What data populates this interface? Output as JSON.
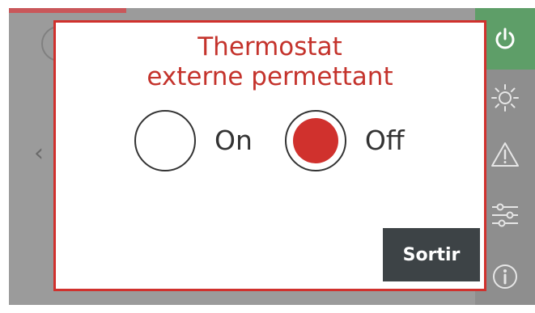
{
  "dialog": {
    "title": "Thermostat\nexterne permettant",
    "options": [
      {
        "label": "On",
        "selected": false
      },
      {
        "label": "Off",
        "selected": true
      }
    ],
    "exit_label": "Sortir"
  },
  "background": {
    "back_icon": "chevron-left-icon"
  },
  "sidebar": {
    "items": [
      {
        "icon": "power-icon",
        "active": true
      },
      {
        "icon": "sun-icon",
        "active": false
      },
      {
        "icon": "warning-icon",
        "active": false
      },
      {
        "icon": "sliders-icon",
        "active": false
      },
      {
        "icon": "info-icon",
        "active": false
      }
    ]
  },
  "colors": {
    "accent_red": "#d0312d",
    "power_green": "#5e9e68",
    "exit_button_bg": "#3d4346"
  }
}
